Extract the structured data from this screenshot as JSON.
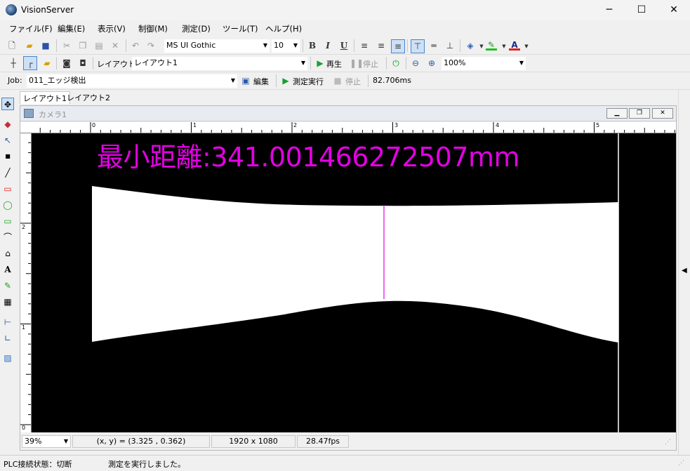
{
  "app": {
    "title": "VisionServer",
    "minimize": "─",
    "maximize": "☐",
    "close": "✕"
  },
  "menu": [
    "ファイル(F)",
    "編集(E)",
    "表示(V)",
    "制御(M)",
    "測定(D)",
    "ツール(T)",
    "ヘルプ(H)"
  ],
  "toolbar1": {
    "font_name": "MS UI Gothic",
    "font_size": "10"
  },
  "toolbar2": {
    "layout_label": "レイアウト",
    "layout_value": "レイアウト1",
    "play_label": "再生",
    "stop_label": "停止",
    "zoom_value": "100%"
  },
  "toolbar3": {
    "job_label": "Job:",
    "job_value": "011_エッジ検出",
    "edit_label": "編集",
    "run_label": "測定実行",
    "stop_label": "停止",
    "elapsed": "82.706ms"
  },
  "tabs": [
    "レイアウト1",
    "レイアウト2"
  ],
  "camera_window": {
    "title": "カメラ1"
  },
  "ruler_top_labels": [
    "0",
    "1",
    "2",
    "3",
    "4",
    "5"
  ],
  "ruler_left_labels": [
    "2",
    "1",
    "0"
  ],
  "overlay": {
    "measurement_text": "最小距離:341.001466272507mm",
    "color": "#e400e4"
  },
  "view_status": {
    "zoom": "39%",
    "coords": "(x, y) = (3.325 , 0.362)",
    "resolution": "1920 x 1080",
    "fps": "28.47fps"
  },
  "statusbar": {
    "plc": "PLC接続状態：切断",
    "message": "測定を実行しました。"
  }
}
